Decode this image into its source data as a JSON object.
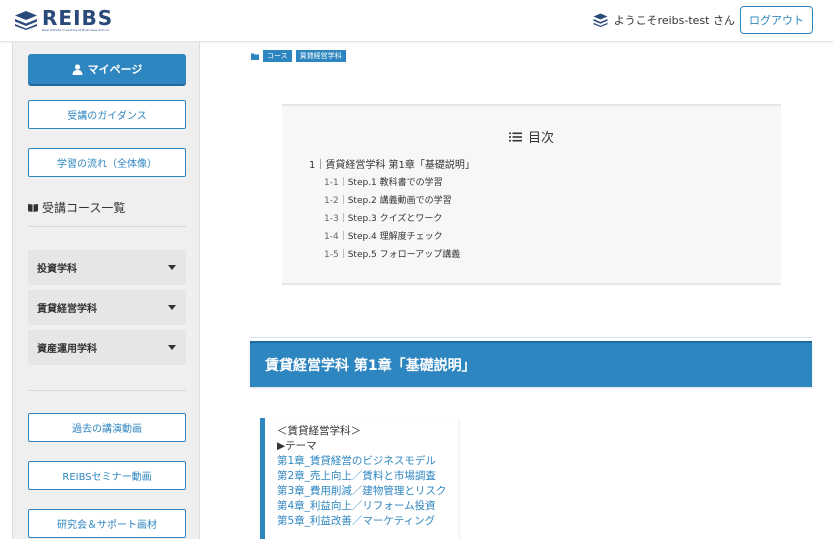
{
  "header": {
    "logo_text": "REIBS",
    "logo_sub": "Real Estate Investment Business School",
    "welcome": "ようこそreibs-test さん",
    "logout": "ログアウト"
  },
  "sidebar": {
    "mypage": "マイページ",
    "guidance": "受講のガイダンス",
    "flow": "学習の流れ（全体像）",
    "course_list_title": "受講コース一覧",
    "courses": [
      "投資学科",
      "賃貸経営学科",
      "資産運用学科"
    ],
    "past_lectures": "過去の講演動画",
    "seminar": "REIBSセミナー動画",
    "research": "研究会＆サポート画材"
  },
  "breadcrumb": {
    "items": [
      "コース",
      "賃貸経営学科"
    ]
  },
  "toc": {
    "title": "目次",
    "chapter": "1｜賃貸経営学科 第1章「基礎説明」",
    "steps": [
      {
        "num": "1-1｜",
        "label": "Step.1 教科書での学習"
      },
      {
        "num": "1-2｜",
        "label": "Step.2 講義動画での学習"
      },
      {
        "num": "1-3｜",
        "label": "Step.3 クイズとワーク"
      },
      {
        "num": "1-4｜",
        "label": "Step.4 理解度チェック"
      },
      {
        "num": "1-5｜",
        "label": "Step.5 フォローアップ講義"
      }
    ]
  },
  "chapter_heading": "賃貸経営学科 第1章「基礎説明」",
  "lesson": {
    "course": "＜賃貸経営学科＞",
    "theme": "▶テーマ",
    "links": [
      "第1章_賃貸経営のビジネスモデル",
      "第2章_売上向上／賃料と市場調査",
      "第3章_費用削減／建物管理とリスク",
      "第4章_利益向上／リフォーム投資",
      "第5章_利益改善／マーケティング"
    ]
  },
  "colors": {
    "accent": "#2e86c1",
    "sidebar_bg": "#efefef"
  }
}
